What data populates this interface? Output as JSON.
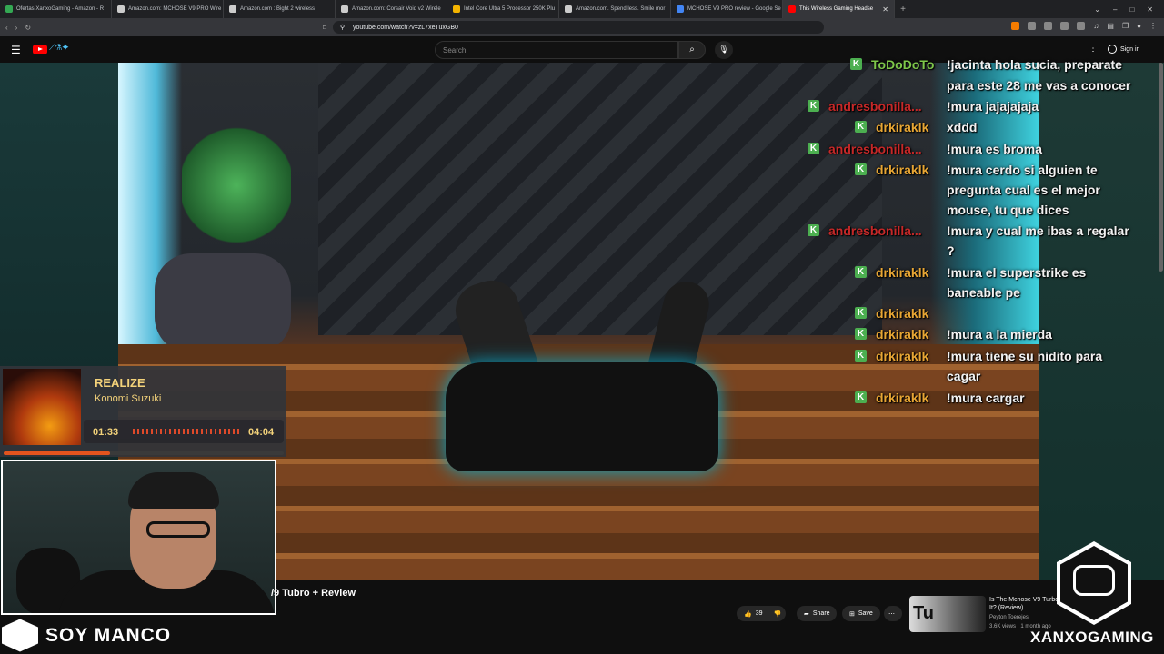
{
  "browser": {
    "tabs": [
      {
        "label": "Ofertas XanxoGaming - Amazon - R",
        "color": "#34a853"
      },
      {
        "label": "Amazon.com: MCHOSE V9 PRO Wire",
        "color": "#cccccc"
      },
      {
        "label": "Amazon.com : Bight 2 wireless",
        "color": "#cccccc"
      },
      {
        "label": "Amazon.com: Corsair Void v2 Wirele",
        "color": "#cccccc"
      },
      {
        "label": "Intel Core Ultra 5 Processor 250K Plu",
        "color": "#f4b400"
      },
      {
        "label": "Amazon.com. Spend less. Smile mor",
        "color": "#cccccc"
      },
      {
        "label": "MCHOSE V9 PRO review - Google Se",
        "color": "#4285f4"
      },
      {
        "label": "This Wireless Gaming Headse",
        "color": "#ff0000",
        "active": true
      }
    ],
    "url": "youtube.com/watch?v=zL7xeTuxGB0"
  },
  "youtube": {
    "search_placeholder": "Search",
    "signin": "Sign in",
    "video_title_fragment": "/9 Tubro + Review",
    "likes": "39",
    "share": "Share",
    "save": "Save",
    "related": {
      "title": "Is The Mchose V9 Turbo Worth It? (Review)",
      "channel": "Peyton Toerejes",
      "meta": "3.6K views · 1 month ago",
      "thumb_text": "Tu"
    }
  },
  "chat": [
    {
      "user": "ToDoDoTo",
      "msg": "!jacinta hola sucia, preparate",
      "ucolor": "nm"
    },
    {
      "user": "",
      "msg": "para este 28 me vas a conocer",
      "ucolor": "nm"
    },
    {
      "user": "andresbonilla...",
      "msg": "!mura jajajajaja",
      "ucolor": "nmr"
    },
    {
      "user": "drkiraklk",
      "msg": "xddd",
      "ucolor": "nmo"
    },
    {
      "user": "andresbonilla...",
      "msg": "!mura es broma",
      "ucolor": "nmr"
    },
    {
      "user": "drkiraklk",
      "msg": "!mura cerdo si alguien te",
      "ucolor": "nmo"
    },
    {
      "user": "",
      "msg": "pregunta cual es el mejor",
      "ucolor": "nmo"
    },
    {
      "user": "",
      "msg": "mouse, tu que dices",
      "ucolor": "nmo"
    },
    {
      "user": "andresbonilla...",
      "msg": "!mura y cual me ibas a regalar",
      "ucolor": "nmr"
    },
    {
      "user": "",
      "msg": "?",
      "ucolor": "nmr"
    },
    {
      "user": "drkiraklk",
      "msg": "!mura el superstrike es",
      "ucolor": "nmo"
    },
    {
      "user": "",
      "msg": "baneable pe",
      "ucolor": "nmo"
    },
    {
      "user": "drkiraklk",
      "msg": "",
      "ucolor": "nmo"
    },
    {
      "user": "drkiraklk",
      "msg": "!mura a la mierda",
      "ucolor": "nmo"
    },
    {
      "user": "drkiraklk",
      "msg": "!mura tiene su nidito para",
      "ucolor": "nmo"
    },
    {
      "user": "",
      "msg": "cagar",
      "ucolor": "nmo"
    },
    {
      "user": "drkiraklk",
      "msg": "!mura cargar",
      "ucolor": "nmo"
    }
  ],
  "music": {
    "title": "REALIZE",
    "artist": "Konomi Suzuki",
    "elapsed": "01:33",
    "total": "04:04",
    "progress": 0.38
  },
  "overlay": {
    "streamer_name": "SOY MANCO",
    "brand": "XANXOGAMING"
  }
}
